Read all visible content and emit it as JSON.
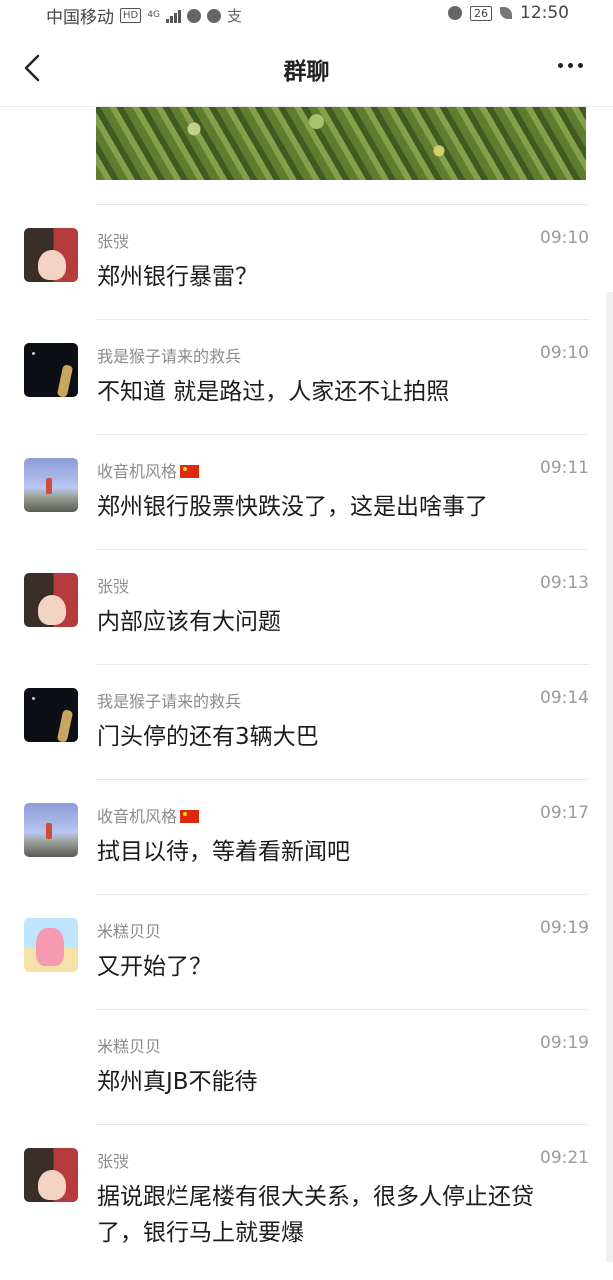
{
  "status_bar": {
    "carrier": "中国移动",
    "network_badge": "HD",
    "network_type": "4G",
    "battery": "26",
    "time": "12:50",
    "icons": [
      "signal-icon",
      "wechat-icon",
      "compass-icon",
      "alipay-icon",
      "alarm-icon",
      "battery-icon",
      "leaf-icon"
    ]
  },
  "nav": {
    "title": "群聊",
    "back_icon": "chevron-left-icon",
    "more_icon": "more-dots-icon"
  },
  "messages": [
    {
      "sender": "张弢",
      "time": "09:10",
      "text": "郑州银行暴雷？",
      "avatar": "zhang",
      "flag": false,
      "show_avatar": true
    },
    {
      "sender": "我是猴子请来的救兵",
      "time": "09:10",
      "text": "不知道 就是路过，人家还不让拍照",
      "avatar": "monkey",
      "flag": false,
      "show_avatar": true
    },
    {
      "sender": "收音机风格",
      "time": "09:11",
      "text": "郑州银行股票快跌没了，这是出啥事了",
      "avatar": "radio",
      "flag": true,
      "show_avatar": true
    },
    {
      "sender": "张弢",
      "time": "09:13",
      "text": "内部应该有大问题",
      "avatar": "zhang",
      "flag": false,
      "show_avatar": true
    },
    {
      "sender": "我是猴子请来的救兵",
      "time": "09:14",
      "text": "门头停的还有3辆大巴",
      "avatar": "monkey",
      "flag": false,
      "show_avatar": true
    },
    {
      "sender": "收音机风格",
      "time": "09:17",
      "text": "拭目以待，等着看新闻吧",
      "avatar": "radio",
      "flag": true,
      "show_avatar": true
    },
    {
      "sender": "米糕贝贝",
      "time": "09:19",
      "text": "又开始了？",
      "avatar": "mi",
      "flag": false,
      "show_avatar": true
    },
    {
      "sender": "米糕贝贝",
      "time": "09:19",
      "text": "郑州真JB不能待",
      "avatar": "mi",
      "flag": false,
      "show_avatar": false
    },
    {
      "sender": "张弢",
      "time": "09:21",
      "text": "据说跟烂尾楼有很大关系，很多人停止还贷了，银行马上就要爆",
      "avatar": "zhang",
      "flag": false,
      "show_avatar": true
    }
  ]
}
